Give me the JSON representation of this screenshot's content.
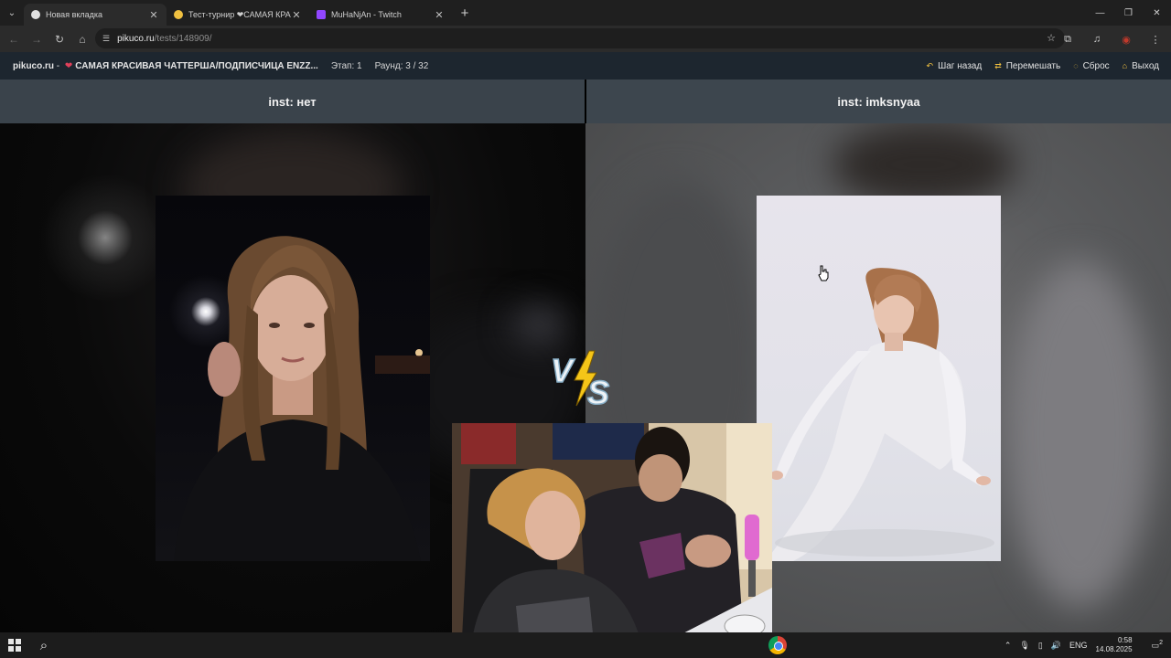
{
  "browser": {
    "tabs": [
      {
        "title": "Новая вкладка",
        "icon": "chrome-icon",
        "active": true
      },
      {
        "title": "Тест-турнир ❤САМАЯ КРАСИ",
        "icon": "pikuco-icon",
        "active": false
      },
      {
        "title": "MuHaNjAn - Twitch",
        "icon": "twitch-icon",
        "active": false
      }
    ],
    "new_tab": "+",
    "address": {
      "host": "pikuco.ru",
      "path": "/tests/148909/"
    }
  },
  "site_header": {
    "brand": "pikuco.ru",
    "separator": " - ",
    "heart": "❤",
    "title": "САМАЯ КРАСИВАЯ ЧАТТЕРША/ПОДПИСЧИЦА ENZZ...",
    "stage": "Этап: 1",
    "round": "Раунд: 3 / 32",
    "actions": [
      {
        "label": "Шаг назад",
        "icon": "undo-icon"
      },
      {
        "label": "Перемешать",
        "icon": "shuffle-icon"
      },
      {
        "label": "Сброс",
        "icon": "reset-icon"
      },
      {
        "label": "Выход",
        "icon": "home-icon"
      }
    ]
  },
  "contestants": {
    "left": {
      "name": "inst: нет"
    },
    "right": {
      "name": "inst: imksnyaa"
    }
  },
  "vs_label": "VS",
  "taskbar": {
    "language": "ENG",
    "time": "0:58",
    "date": "14.08.2025",
    "notifications": "2"
  },
  "colors": {
    "header_bg": "#1d262f",
    "name_bar_bg": "#3a434b",
    "accent_icon": "#f0c040",
    "heart": "#e0405a"
  }
}
